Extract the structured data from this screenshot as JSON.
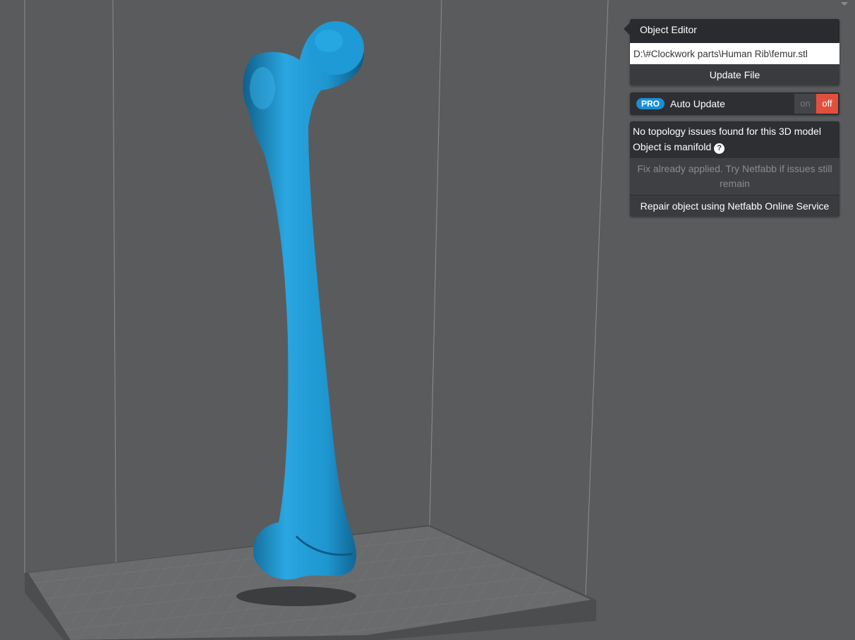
{
  "object_editor": {
    "title": "Object Editor",
    "file_path": "D:\\#Clockwork parts\\Human Rib\\femur.stl",
    "update_button": "Update File"
  },
  "auto_update": {
    "badge": "PRO",
    "label": "Auto Update",
    "on_label": "on",
    "off_label": "off",
    "state": "off"
  },
  "topology": {
    "status": "No topology issues found for this 3D model",
    "manifold": "Object is manifold",
    "help_icon": "?",
    "fix_note": "Fix already applied. Try Netfabb if issues still remain",
    "repair_button": "Repair object using Netfabb Online Service"
  },
  "colors": {
    "model": "#1e9fd8",
    "background": "#5a5b5d",
    "toggle_off": "#e0503d",
    "pro_badge": "#1a8fd6"
  }
}
